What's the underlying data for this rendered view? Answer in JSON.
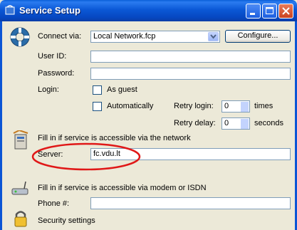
{
  "window": {
    "title": "Service Setup"
  },
  "connect": {
    "label": "Connect via:",
    "value": "Local Network.fcp",
    "configure_label": "Configure..."
  },
  "credentials": {
    "user_label": "User ID:",
    "user_value": "",
    "password_label": "Password:",
    "password_value": ""
  },
  "login": {
    "label": "Login:",
    "guest_label": "As guest",
    "auto_label": "Automatically",
    "retry_login_label": "Retry login:",
    "retry_login_value": "0",
    "retry_login_unit": "times",
    "retry_delay_label": "Retry delay:",
    "retry_delay_value": "0",
    "retry_delay_unit": "seconds"
  },
  "network": {
    "hint": "Fill in if service is accessible via the network",
    "server_label": "Server:",
    "server_value": "fc.vdu.lt"
  },
  "modem": {
    "hint": "Fill in if service is accessible via modem or ISDN",
    "phone_label": "Phone #:",
    "phone_value": ""
  },
  "security": {
    "label": "Security settings"
  },
  "colors": {
    "highlight_ellipse": "#e01818",
    "title_bar": "#0b58d6"
  }
}
